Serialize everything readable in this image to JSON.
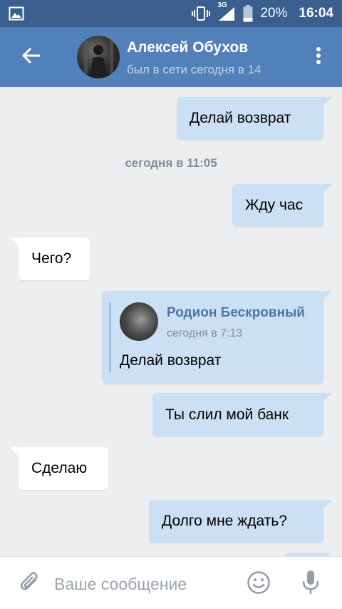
{
  "status_bar": {
    "network_label": "3G",
    "battery_text": "20%",
    "time": "16:04",
    "icons": [
      "image-icon",
      "vibrate-icon",
      "signal-icon",
      "battery-icon"
    ]
  },
  "header": {
    "title": "Алексей Обухов",
    "subtitle": "был в сети сегодня в 14",
    "icons": [
      "back-arrow-icon",
      "more-vertical-icon"
    ]
  },
  "messages": [
    {
      "direction": "out",
      "text": "Делай возврат"
    },
    {
      "type": "date",
      "text": "сегодня в 11:05"
    },
    {
      "direction": "out",
      "text": "Жду час"
    },
    {
      "direction": "in",
      "text": "Чего?"
    },
    {
      "direction": "out",
      "type": "forward",
      "forward": {
        "name": "Родион Бескровный",
        "time": "сегодня в 7:13",
        "text": "Делай возврат"
      }
    },
    {
      "direction": "out",
      "text": "Ты слил мой банк"
    },
    {
      "direction": "in",
      "text": "Сделаю"
    },
    {
      "direction": "out",
      "text": "Долго мне ждать?"
    }
  ],
  "compose": {
    "placeholder": "Ваше сообщение",
    "value": "",
    "icons": [
      "attach-icon",
      "emoji-icon",
      "microphone-icon"
    ]
  },
  "colors": {
    "status_bar": "#3a5f8e",
    "header": "#5181b8",
    "background": "#edeef0",
    "outgoing_bubble": "#cce0f5",
    "incoming_bubble": "#ffffff",
    "forward_name": "#4d76a4",
    "muted_text": "#828c99"
  }
}
